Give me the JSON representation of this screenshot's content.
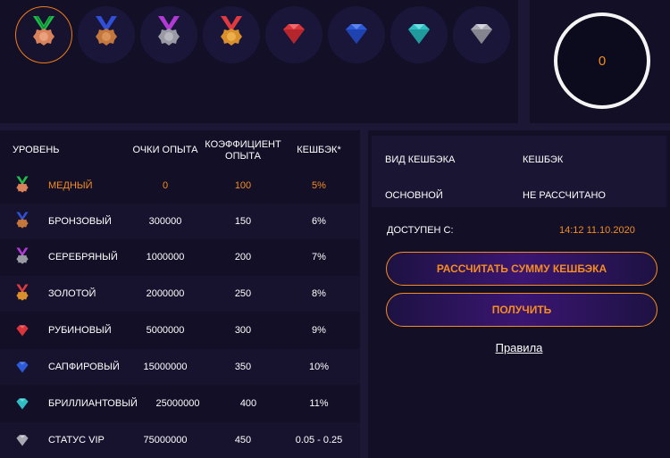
{
  "levels_strip": {
    "icons": [
      {
        "name": "copper-medal-icon",
        "ribbon": "#1fbf4a",
        "medal": "#d8815a",
        "active": true
      },
      {
        "name": "bronze-medal-icon",
        "ribbon": "#2f4fd6",
        "medal": "#c4773c",
        "active": false
      },
      {
        "name": "silver-medal-icon",
        "ribbon": "#b13ad6",
        "medal": "#9a9aa4",
        "active": false
      },
      {
        "name": "gold-medal-icon",
        "ribbon": "#e03a40",
        "medal": "#d9902c",
        "active": false
      },
      {
        "name": "ruby-gem-icon",
        "gem": "#d9353b",
        "active": false
      },
      {
        "name": "sapphire-gem-icon",
        "gem": "#2c5ad8",
        "active": false
      },
      {
        "name": "diamond-gem-icon",
        "gem": "#2fbfc2",
        "active": false
      },
      {
        "name": "vip-gem-icon",
        "gem": "#a9a9b3",
        "active": false
      }
    ]
  },
  "balance": {
    "value": "0"
  },
  "table": {
    "headers": {
      "level": "УРОВЕНЬ",
      "points": "ОЧКИ ОПЫТА",
      "coef_line1": "КОЭФФИЦИЕНТ",
      "coef_line2": "ОПЫТА",
      "cashback": "КЕШБЭК*"
    },
    "rows": [
      {
        "name": "МЕДНЫЙ",
        "points": "0",
        "coef": "100",
        "cashback": "5%"
      },
      {
        "name": "БРОНЗОВЫЙ",
        "points": "300000",
        "coef": "150",
        "cashback": "6%"
      },
      {
        "name": "СЕРЕБРЯНЫЙ",
        "points": "1000000",
        "coef": "200",
        "cashback": "7%"
      },
      {
        "name": "ЗОЛОТОЙ",
        "points": "2000000",
        "coef": "250",
        "cashback": "8%"
      },
      {
        "name": "РУБИНОВЫЙ",
        "points": "5000000",
        "coef": "300",
        "cashback": "9%"
      },
      {
        "name": "САПФИРОВЫЙ",
        "points": "15000000",
        "coef": "350",
        "cashback": "10%"
      },
      {
        "name": "БРИЛЛИАНТОВЫЙ",
        "points": "25000000",
        "coef": "400",
        "cashback": "11%"
      },
      {
        "name": "СТАТУС VIP",
        "points": "75000000",
        "coef": "450",
        "cashback": "0.05 - 0.25"
      }
    ]
  },
  "cashback_panel": {
    "col_type": "ВИД КЕШБЭКА",
    "col_cashback": "КЕШБЭК",
    "type_value": "ОСНОВНОЙ",
    "cashback_value": "НЕ РАССЧИТАНО",
    "available_label": "ДОСТУПЕН С:",
    "available_value": "14:12 11.10.2020",
    "calc_button": "РАССЧИТАТЬ СУММУ КЕШБЭКА",
    "receive_button": "ПОЛУЧИТЬ",
    "rules_link": "Правила"
  },
  "colors": {
    "accent": "#f68d1e",
    "panel": "#120f27",
    "background": "#1c1734"
  }
}
